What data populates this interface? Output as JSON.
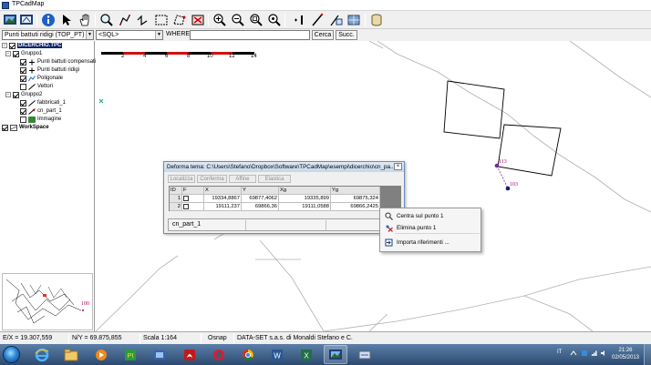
{
  "window": {
    "title": "TPCadMap"
  },
  "query": {
    "layer_combo": "Punti battuti ridigi (TOP_PT)",
    "sql_combo": "<SQL>",
    "where_label": "WHERE",
    "where_value": "",
    "search_button": "Cerca",
    "next_button": "Succ."
  },
  "tree": {
    "root": "DICERCHIO.TPC",
    "group1": {
      "label": "Gruppo1",
      "items": [
        "Punti battuti compensati",
        "Punti battuti ridigi",
        "Poligonale",
        "Vettori"
      ]
    },
    "group2": {
      "label": "Gruppo2",
      "items": [
        "fabbricati_1",
        "cn_part_1",
        "Immagine"
      ]
    },
    "workspace": "WorkSpace"
  },
  "scale_bar": {
    "ticks": [
      "2",
      "4",
      "6",
      "8",
      "10",
      "12",
      "14"
    ],
    "colors": [
      "#000000",
      "#cc1111"
    ]
  },
  "map": {
    "point_labels": [
      "113",
      "103"
    ],
    "overview_label": "100",
    "colors": {
      "polygon": "#000000",
      "link": "#7a2a9a",
      "point": "#b0006a"
    }
  },
  "dialog": {
    "title": "Deforma tema: C:\\Users\\Stefano\\Dropbox\\Software\\TPCadMap\\esempi\\dicerchio\\cn_pa...",
    "tabs": [
      "Localizza",
      "Conferma",
      "Affine",
      "Elastica"
    ],
    "columns": [
      "ID",
      "F",
      "X",
      "Y",
      "Xg",
      "Yg"
    ],
    "rows": [
      {
        "id": "1",
        "x": "19334,8867",
        "y": "69877,4062",
        "xg": "19335,899",
        "yg": "69875,324"
      },
      {
        "id": "2",
        "x": "19111,237",
        "y": "69866,36",
        "xg": "19111,0588",
        "yg": "69866,2425"
      }
    ],
    "footer_name": "cn_part_1"
  },
  "context_menu": {
    "items": [
      "Centra sul punto 1",
      "Elimina punto 1",
      "Importa riferimenti ..."
    ]
  },
  "status": {
    "ex": "E/X = 19.307,559",
    "ny": "N/Y = 69.875,855",
    "scale": "Scala 1:164",
    "osnap": "Osnap",
    "company": "DATA-SET s.a.s. di Monaldi Stefano e C."
  },
  "taskbar": {
    "language": "IT",
    "time": "21:26",
    "date": "02/05/2013"
  }
}
